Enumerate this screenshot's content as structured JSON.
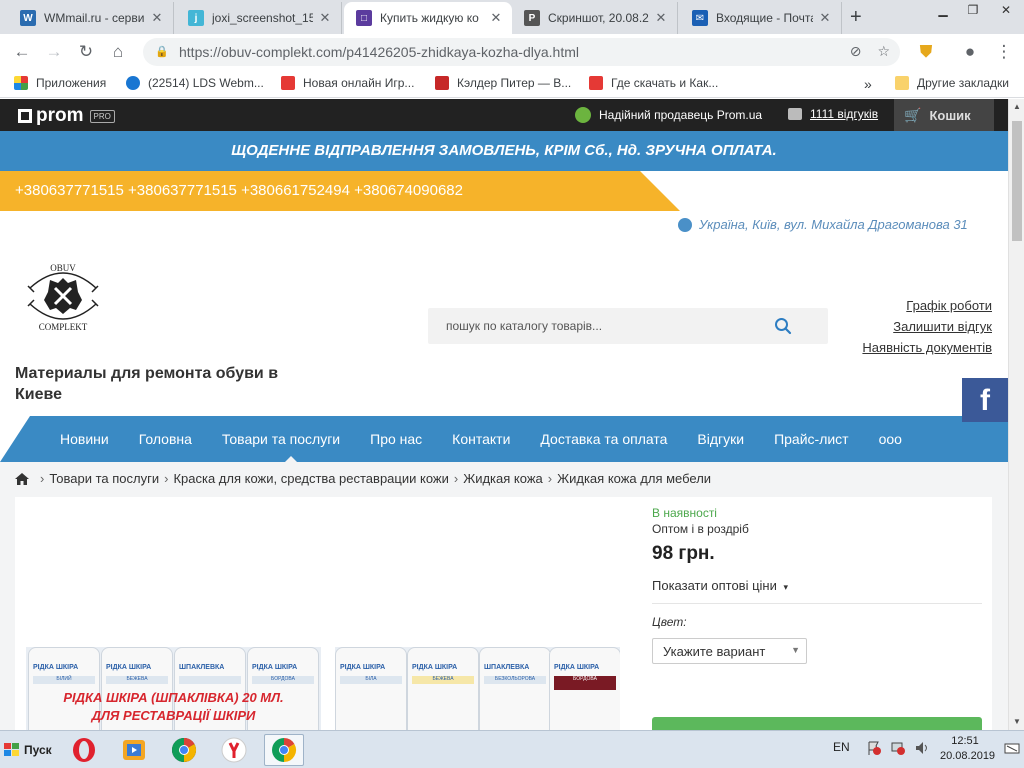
{
  "browser": {
    "tabs": [
      {
        "title": "WMmail.ru - серви",
        "color": "#2b6cb0",
        "glyph": "W",
        "active": false
      },
      {
        "title": "joxi_screenshot_15€",
        "color": "#43b6d6",
        "glyph": "j",
        "active": false
      },
      {
        "title": "Купить жидкую ко",
        "color": "#5b3b9e",
        "glyph": "□",
        "active": true
      },
      {
        "title": "Скриншот, 20.08.2(",
        "color": "#555555",
        "glyph": "P",
        "active": false
      },
      {
        "title": "Входящие - Почта",
        "color": "#1a5fb4",
        "glyph": "✉",
        "active": false
      }
    ],
    "url_host": "https://obuv-complekt.com",
    "url_path": "/p41426205-zhidkaya-kozha-dlya.html",
    "bookmarks": [
      {
        "label": "Приложения",
        "color": "#e53935"
      },
      {
        "label": "(22514) LDS Webm...",
        "color": "#1976d2"
      },
      {
        "label": "Новая онлайн Игр...",
        "color": "#e53935"
      },
      {
        "label": "Кэлдер Питер — В...",
        "color": "#c62828"
      },
      {
        "label": "Где скачать и Как...",
        "color": "#e53935"
      }
    ],
    "bookmarks_more": "»",
    "other_bookmarks": "Другие закладки"
  },
  "site": {
    "prom": {
      "logo_text": "prom",
      "pro_badge": "PRO",
      "seller": "Надійний продавець Prom.ua",
      "reviews": "1111 відгуків",
      "cart": "Кошик"
    },
    "banner": "ЩОДЕННЕ ВІДПРАВЛЕННЯ ЗАМОВЛЕНЬ, КРІМ Сб., Нд. ЗРУЧНА ОПЛАТА.",
    "phones": "+380637771515 +380637771515 +380661752494 +380674090682",
    "address": "Україна, Київ, вул. Михайла Драгоманова 31",
    "logo_text_top": "OBUV",
    "logo_text_bottom": "COMPLEKT",
    "search_placeholder": "пошук по каталогу товарів...",
    "header_links": [
      "Графік роботи",
      "Залишити відгук",
      "Наявність документів"
    ],
    "company_name": "Материалы для ремонта обуви в Киеве",
    "facebook": "f",
    "nav": [
      "Новини",
      "Головна",
      "Товари та послуги",
      "Про нас",
      "Контакти",
      "Доставка та оплата",
      "Відгуки",
      "Прайс-лист",
      "ооо"
    ],
    "breadcrumbs": [
      "Товари та послуги",
      "Краска для кожи, средства реставрации кожи",
      "Жидкая кожа",
      "Жидкая кожа для мебели"
    ],
    "product": {
      "image_overlay_line1": "РІДКА ШКІРА (ШПАКЛІВКА) 20 МЛ.",
      "image_overlay_line2": "ДЛЯ РЕСТАВРАЦІЇ ШКІРИ",
      "jars_left": [
        {
          "title": "РІДКА ШКІРА",
          "sub": "БІЛИЙ"
        },
        {
          "title": "РІДКА ШКІРА",
          "sub": "БЕЖЕВА"
        },
        {
          "title": "ШПАКЛЕВКА",
          "sub": ""
        },
        {
          "title": "РІДКА ШКІРА",
          "sub": "БОРДОВА"
        }
      ],
      "jars_right": [
        {
          "title": "РІДКА ШКІРА",
          "sub": "БІЛА"
        },
        {
          "title": "РІДКА ШКІРА",
          "sub": "БЕЖЕВА"
        },
        {
          "title": "ШПАКЛЕВКА",
          "sub": "БЕЗКОЛЬОРОВА"
        },
        {
          "title": "РІДКА ШКІРА",
          "sub": "БОРДОВА"
        }
      ],
      "availability": "В наявності",
      "wholesale": "Оптом і в роздріб",
      "price": "98 грн.",
      "show_prices": "Показати оптові ціни",
      "color_label": "Цвет:",
      "color_select": "Укажите вариант"
    }
  },
  "taskbar": {
    "start": "Пуск",
    "lang": "EN",
    "time": "12:51",
    "date": "20.08.2019"
  }
}
